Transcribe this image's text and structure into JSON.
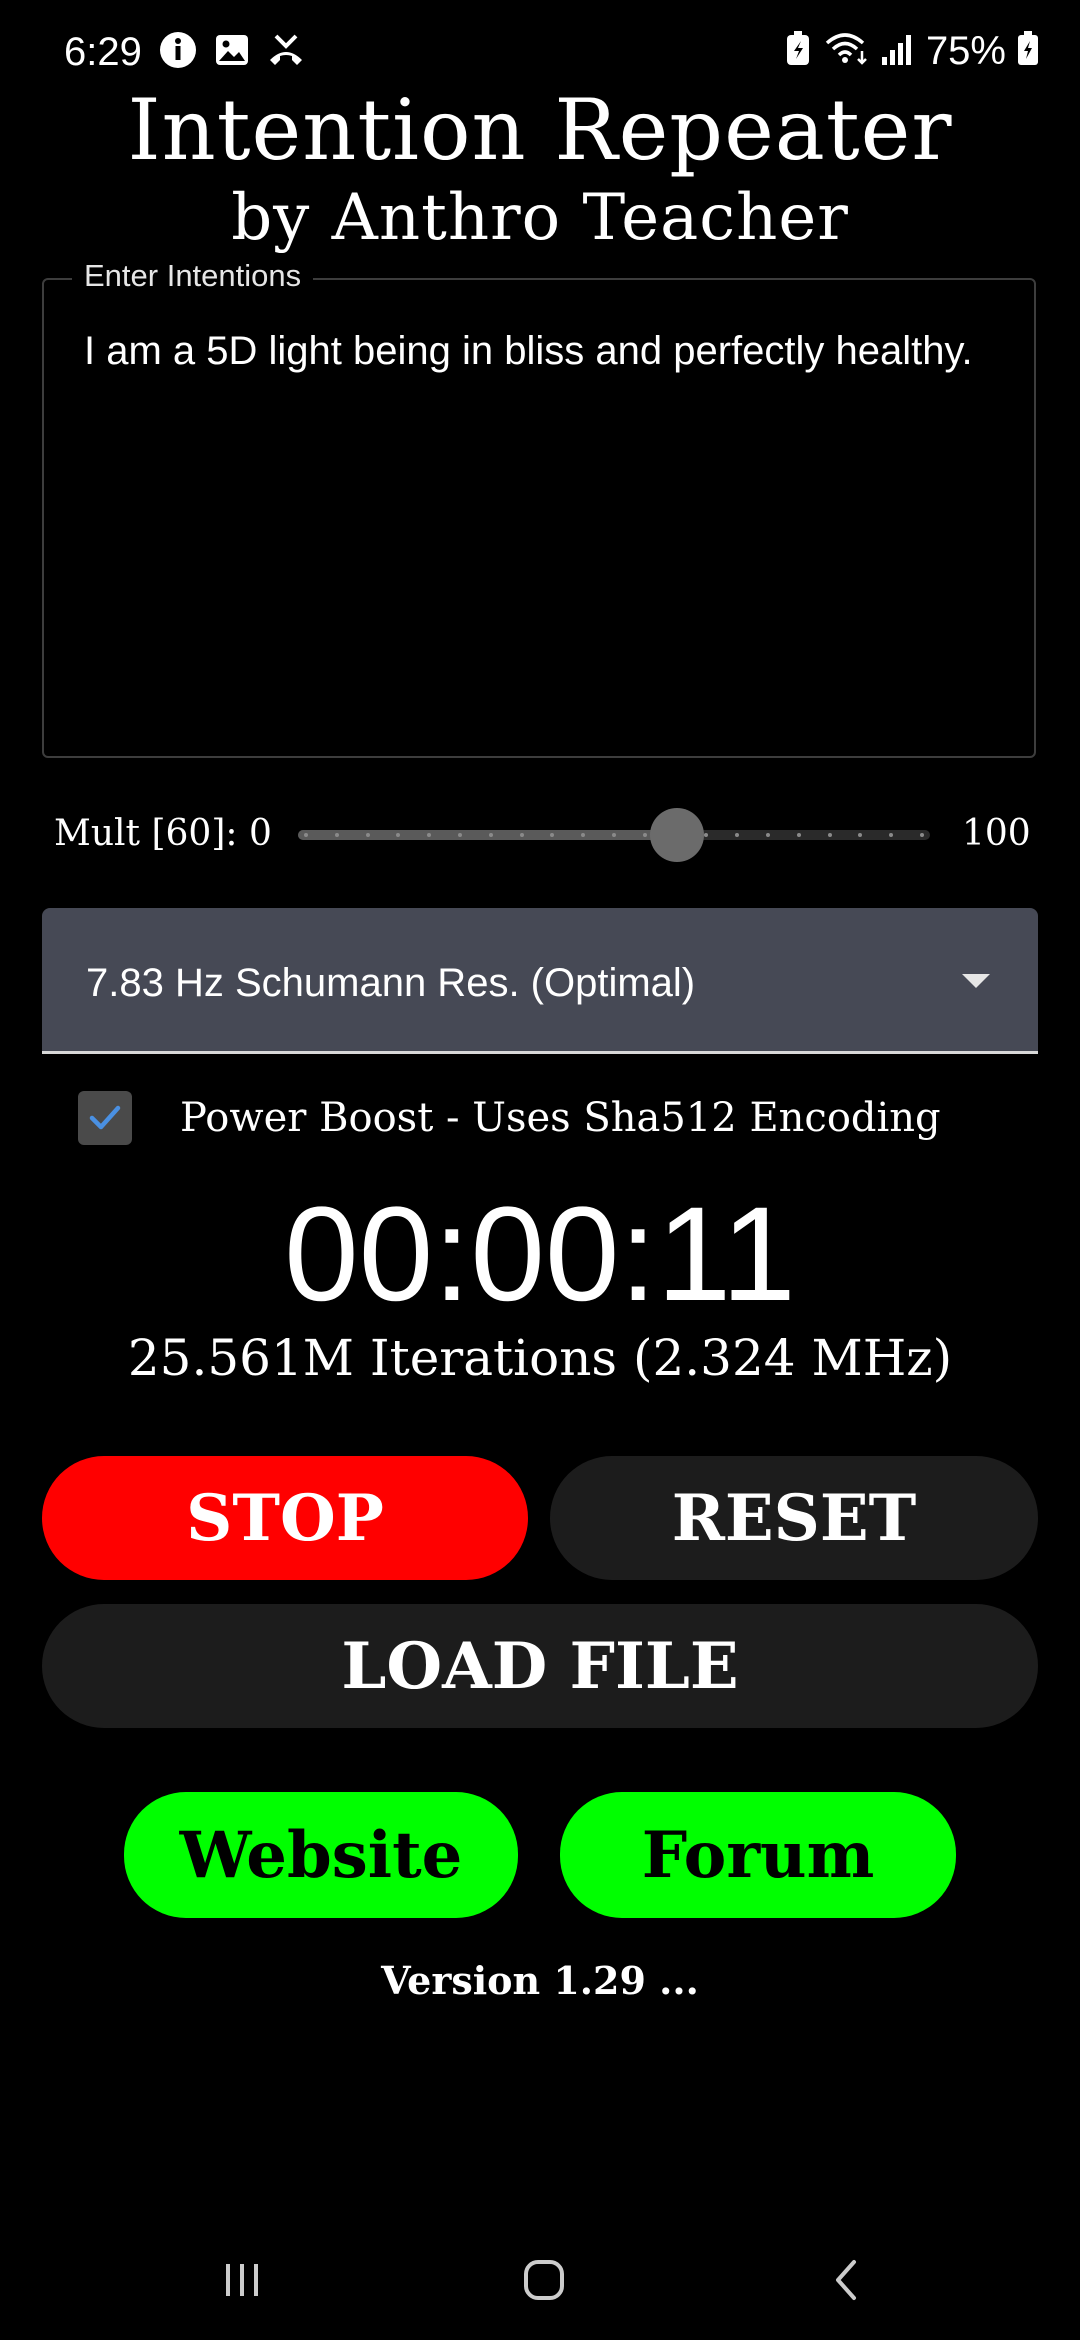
{
  "status_bar": {
    "time": "6:29",
    "battery_percent": "75%",
    "left_icons": [
      "info-icon",
      "image-icon",
      "missed-call-icon"
    ],
    "right_icons": [
      "battery-saver-icon",
      "wifi-icon",
      "signal-icon",
      "battery-icon"
    ]
  },
  "header": {
    "title": "Intention Repeater",
    "subtitle": "by Anthro Teacher"
  },
  "intentions": {
    "label": "Enter Intentions",
    "value": "I am a 5D light being in bliss and perfectly healthy."
  },
  "multiplier_slider": {
    "label": "Mult [60]: 0",
    "max_label": "100",
    "value": 60,
    "min": 0,
    "max": 100
  },
  "frequency_dropdown": {
    "selected": "7.83 Hz Schumann Res. (Optimal)"
  },
  "power_boost": {
    "label": "Power Boost - Uses Sha512 Encoding",
    "checked": true
  },
  "timer": {
    "elapsed": "00:00:11",
    "iterations": "25.561M Iterations (2.324 MHz)"
  },
  "buttons": {
    "stop": "STOP",
    "reset": "RESET",
    "load_file": "LOAD FILE",
    "website": "Website",
    "forum": "Forum"
  },
  "footer": {
    "version": "Version 1.29 ..."
  },
  "nav_bar": {
    "icons": [
      "recent-apps-icon",
      "home-icon",
      "back-icon"
    ]
  },
  "colors": {
    "background": "#000000",
    "stop_button": "#ff0000",
    "secondary_button": "#1c1c1c",
    "link_button": "#00ff00",
    "dropdown_bg": "#464955",
    "checkbox_check": "#4a90e2"
  }
}
